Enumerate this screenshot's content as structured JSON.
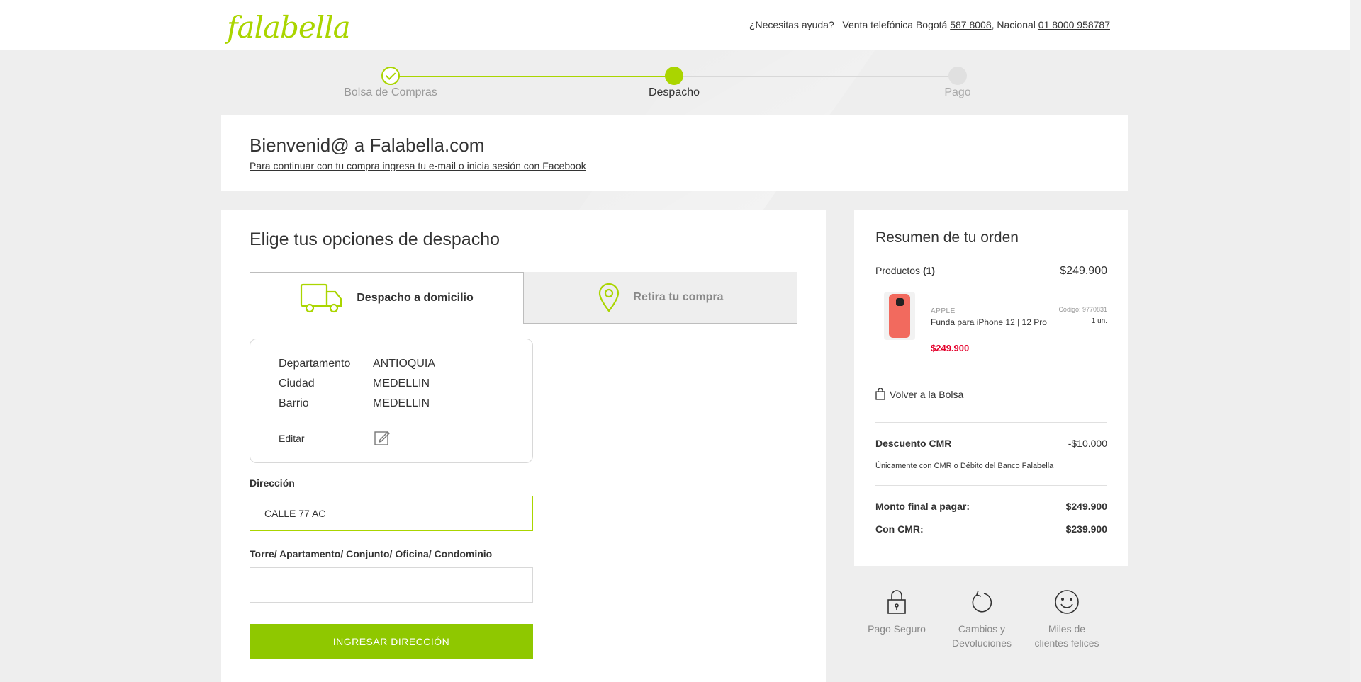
{
  "header": {
    "logo": "falabella",
    "help_text": "¿Necesitas ayuda?",
    "phone_label": "Venta telefónica Bogotá",
    "phone_bogota": "587 8008",
    "phone_sep": ", Nacional",
    "phone_national": "01 8000 958787"
  },
  "steps": [
    {
      "label": "Bolsa de Compras",
      "status": "done"
    },
    {
      "label": "Despacho",
      "status": "active"
    },
    {
      "label": "Pago",
      "status": "pending"
    }
  ],
  "welcome": {
    "title": "Bienvenid@ a Falabella.com",
    "link": "Para continuar con tu compra ingresa tu e-mail o inicia sesión con Facebook"
  },
  "delivery": {
    "title": "Elige tus opciones de despacho",
    "tabs": [
      {
        "label": "Despacho a domicilio",
        "icon": "truck-icon",
        "selected": true
      },
      {
        "label": "Retira tu compra",
        "icon": "location-pin-icon",
        "selected": false
      }
    ],
    "location": {
      "dept_label": "Departamento",
      "dept_value": "ANTIOQUIA",
      "city_label": "Ciudad",
      "city_value": "MEDELLIN",
      "barrio_label": "Barrio",
      "barrio_value": "MEDELLIN",
      "edit": "Editar"
    },
    "address_label": "Dirección",
    "address_value": "CALLE 77 AC",
    "apt_label": "Torre/ Apartamento/ Conjunto/ Oficina/ Condominio",
    "apt_value": "",
    "submit": "INGRESAR DIRECCIÓN"
  },
  "summary": {
    "title": "Resumen de tu orden",
    "products_label": "Productos",
    "products_count": "(1)",
    "products_total": "$249.900",
    "item": {
      "brand": "APPLE",
      "name": "Funda para iPhone 12 | 12 Pro",
      "code": "Código: 9770831",
      "qty": "1 un.",
      "price": "$249.900"
    },
    "back_to_bag": "Volver a la Bolsa",
    "discount_label": "Descuento CMR",
    "discount_value": "-$10.000",
    "discount_note": "Únicamente con CMR o Débito del Banco Falabella",
    "final_label": "Monto final a pagar:",
    "final_value": "$249.900",
    "cmr_label": "Con CMR:",
    "cmr_value": "$239.900"
  },
  "trust": [
    {
      "line1": "Pago Seguro",
      "line2": "",
      "icon": "lock-icon"
    },
    {
      "line1": "Cambios y",
      "line2": "Devoluciones",
      "icon": "return-arrow-icon"
    },
    {
      "line1": "Miles de",
      "line2": "clientes felices",
      "icon": "smiley-icon"
    }
  ],
  "colors": {
    "brand": "#aad500",
    "button": "#8fc800",
    "price": "#e4002b",
    "background": "#eeeeee"
  }
}
